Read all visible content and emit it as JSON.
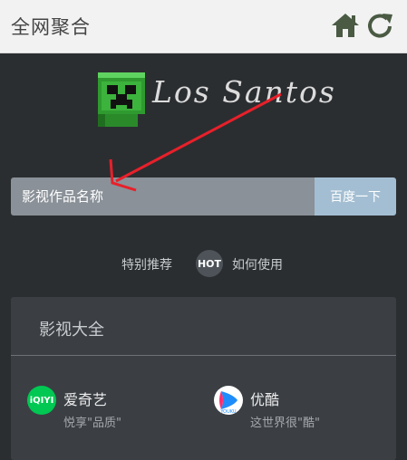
{
  "header": {
    "title": "全网聚合",
    "home_icon": "home-icon",
    "refresh_icon": "refresh-icon"
  },
  "logo": {
    "text": "Los Santos",
    "icon": "creeper-icon"
  },
  "search": {
    "placeholder": "影视作品名称",
    "value": "",
    "button_label": "百度一下"
  },
  "links": {
    "recommend": "特别推荐",
    "hot_badge": "HOT",
    "howto": "如何使用"
  },
  "panel": {
    "title": "影视大全",
    "platforms": [
      {
        "name": "爱奇艺",
        "slogan": "悦享\"品质\"",
        "logo_text": "iQIYI",
        "color": "#00c853"
      },
      {
        "name": "优酷",
        "slogan": "这世界很\"酷\"",
        "logo_text": "YOUKU",
        "color": "#1f8cfb"
      }
    ]
  },
  "colors": {
    "background": "#2b2e31",
    "header_bg": "#f2f2f2",
    "accent": "#a3bed2",
    "annotation_arrow": "#e8202a"
  }
}
